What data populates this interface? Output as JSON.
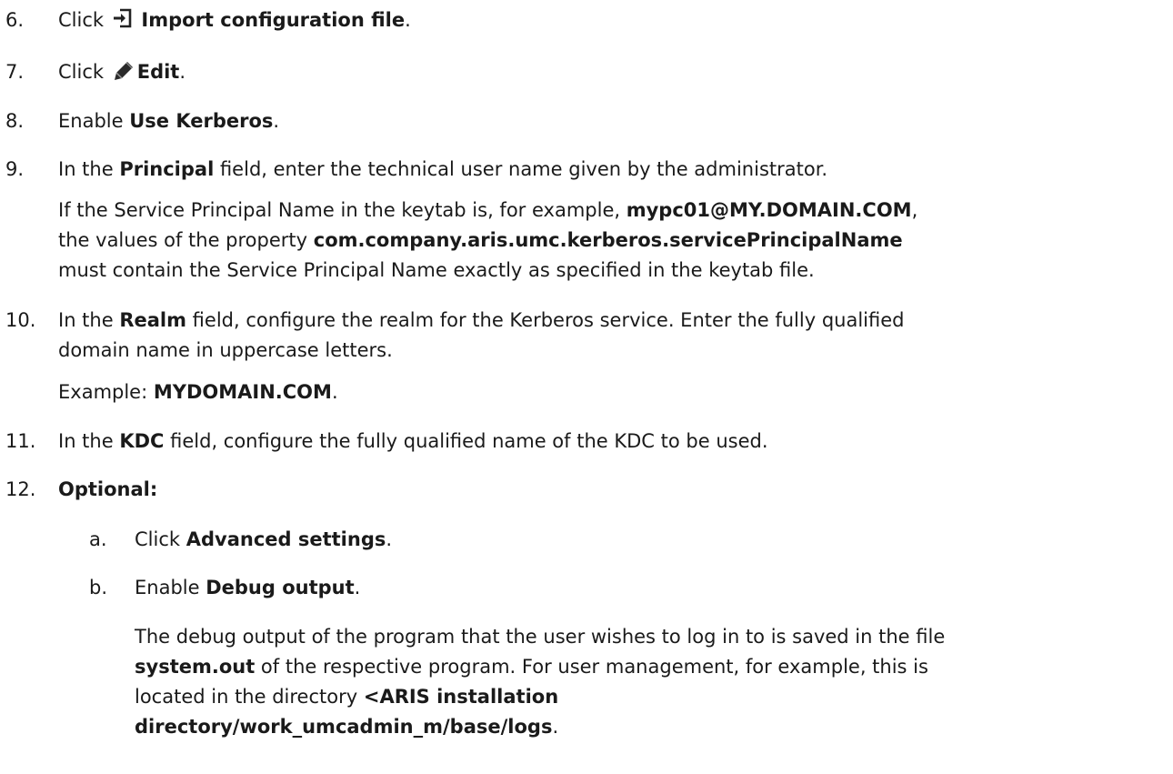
{
  "steps": [
    {
      "num": "6.",
      "pre": "Click",
      "icon": "import-icon",
      "bold": "Import configuration file",
      "post": "."
    },
    {
      "num": "7.",
      "pre": "Click",
      "icon": "pencil-icon",
      "bold": "Edit",
      "post": "."
    },
    {
      "num": "8.",
      "pre": "Enable ",
      "bold": "Use Kerberos",
      "post": "."
    },
    {
      "num": "9.",
      "pre": "In the ",
      "bold": "Principal",
      "post": " field, enter the technical user name given by the administrator.",
      "note": {
        "a": "If the Service Principal Name in the keytab is, for example, ",
        "b1": "mypc01@MY.DOMAIN.COM",
        "c": ",",
        "d": "the values of the property ",
        "b2": "com.company.aris.umc.kerberos.servicePrincipalName",
        "e": "must contain the Service Principal Name exactly as specified in the keytab file."
      }
    },
    {
      "num": "10.",
      "pre": "In the ",
      "bold": "Realm",
      "post": " field, configure the realm for the Kerberos service. Enter the fully qualified",
      "cont": "domain name in uppercase letters.",
      "example_pre": "Example: ",
      "example_bold": "MYDOMAIN.COM",
      "example_post": "."
    },
    {
      "num": "11.",
      "pre": "In the ",
      "bold": "KDC",
      "post": " field, configure the fully qualified name of the KDC to be used."
    },
    {
      "num": "12.",
      "bold": "Optional:"
    }
  ],
  "substeps": [
    {
      "label": "a.",
      "pre": "Click ",
      "bold": "Advanced settings",
      "post": "."
    },
    {
      "label": "b.",
      "pre": "Enable ",
      "bold": "Debug output",
      "post": "."
    }
  ],
  "debug_note": {
    "l1": "The debug output of the program that the user wishes to log in to is saved in the file",
    "l2_bold": "system.out",
    "l2_rest": " of the respective program. For user management, for example, this is",
    "l3": "located in the directory ",
    "l3_bold": "<ARIS installation",
    "l4_bold": "directory/work_umcadmin_m/base/logs",
    "l4_rest": "."
  }
}
